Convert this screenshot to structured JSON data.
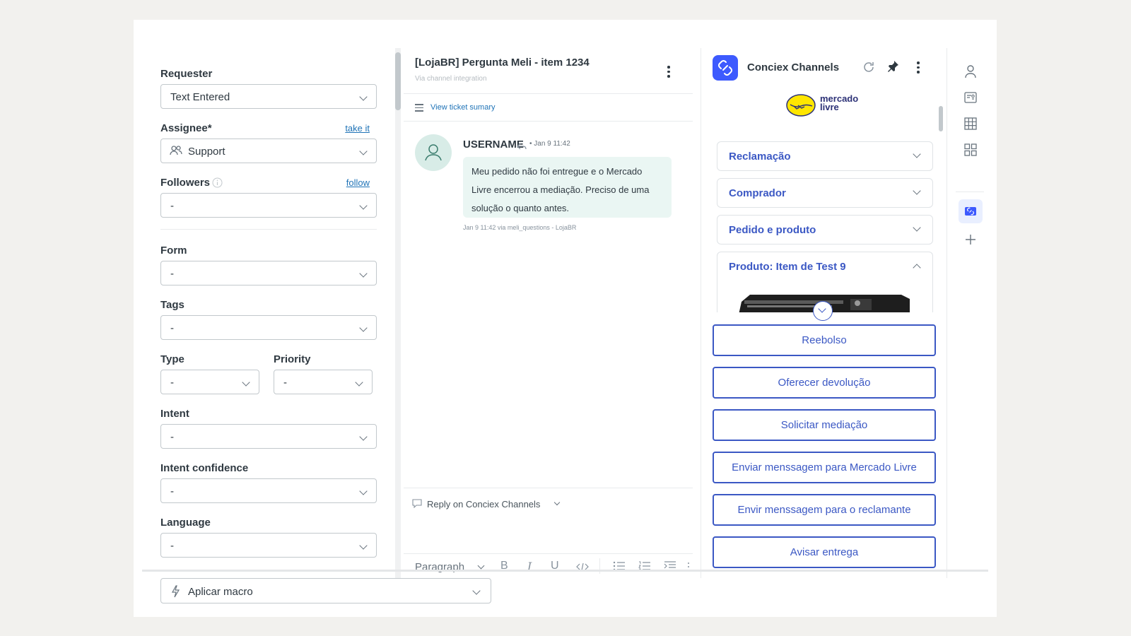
{
  "properties": {
    "requester": {
      "label": "Requester",
      "value": "Text Entered"
    },
    "assignee": {
      "label": "Assignee*",
      "link": "take it",
      "value": "Support"
    },
    "followers": {
      "label": "Followers",
      "link": "follow",
      "value": "-"
    },
    "form": {
      "label": "Form",
      "value": "-"
    },
    "tags": {
      "label": "Tags",
      "value": "-"
    },
    "type": {
      "label": "Type",
      "value": "-"
    },
    "priority": {
      "label": "Priority",
      "value": "-"
    },
    "intent": {
      "label": "Intent",
      "value": "-"
    },
    "intent_confidence": {
      "label": "Intent confidence",
      "value": "-"
    },
    "language": {
      "label": "Language",
      "value": "-"
    }
  },
  "conversation": {
    "title": "[LojaBR] Pergunta Meli - item 1234",
    "subtitle": "Via channel integration",
    "summary_link": "View ticket sumary",
    "message": {
      "user": "USERNAME",
      "meta": "• Jan 9 11:42",
      "text": "Meu pedido não foi entregue e o Mercado Livre encerrou a mediação. Preciso de uma solução o quanto antes.",
      "footer": "Jan 9 11:42 via meli_questions - LojaBR"
    },
    "reply_label": "Reply on Conciex Channels",
    "toolbar": {
      "paragraph": "Paragraph"
    }
  },
  "app": {
    "title": "Conciex Channels",
    "marketplace_logo_text": "mercado livre",
    "sections": [
      {
        "label": "Reclamação"
      },
      {
        "label": "Comprador"
      },
      {
        "label": "Pedido e produto"
      },
      {
        "label": "Produto: Item de Test 9"
      }
    ],
    "actions": [
      {
        "label": "Reebolso"
      },
      {
        "label": "Oferecer devolução"
      },
      {
        "label": "Solicitar mediação"
      },
      {
        "label": "Enviar menssagem para Mercado Livre"
      },
      {
        "label": "Envir menssagem para o reclamante"
      },
      {
        "label": "Avisar entrega"
      }
    ],
    "accent_color": "#3b58c4"
  },
  "bottom": {
    "macro_label": "Aplicar macro"
  }
}
